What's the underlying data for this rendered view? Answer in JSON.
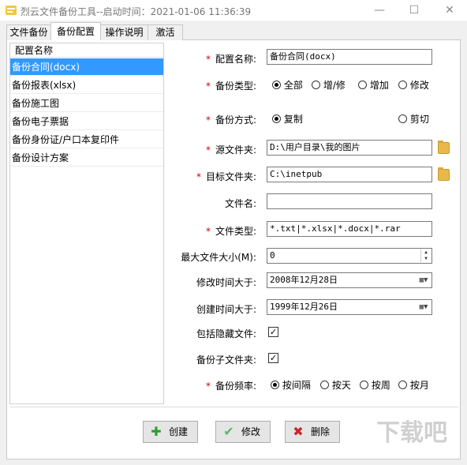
{
  "window": {
    "title": "烈云文件备份工具--启动时间：2021-01-06 11:36:39",
    "minimize_glyph": "—",
    "maximize_glyph": "☐",
    "close_glyph": "✕"
  },
  "tabs": [
    {
      "label": "文件备份"
    },
    {
      "label": "备份配置"
    },
    {
      "label": "操作说明"
    },
    {
      "label": "激活"
    }
  ],
  "config_list": {
    "header": "配置名称",
    "items": [
      {
        "label": "备份合同(docx)",
        "selected": true
      },
      {
        "label": "备份报表(xlsx)"
      },
      {
        "label": "备份施工图"
      },
      {
        "label": "备份电子票据"
      },
      {
        "label": "备份身份证/户口本复印件"
      },
      {
        "label": "备份设计方案"
      }
    ]
  },
  "form": {
    "config_name": {
      "label": "配置名称:",
      "value": "备份合同(docx)"
    },
    "backup_type": {
      "label": "备份类型:",
      "options": [
        "全部",
        "增/修",
        "增加",
        "修改"
      ],
      "selected": "全部"
    },
    "backup_method": {
      "label": "备份方式:",
      "options": [
        "复制",
        "剪切"
      ],
      "selected": "复制"
    },
    "source_folder": {
      "label": "源文件夹:",
      "value": "D:\\用户目录\\我的图片"
    },
    "target_folder": {
      "label": "目标文件夹:",
      "value": "C:\\inetpub"
    },
    "file_name": {
      "label": "文件名:",
      "value": ""
    },
    "file_types": {
      "label": "文件类型:",
      "value": "*.txt|*.xlsx|*.docx|*.rar"
    },
    "max_size": {
      "label": "最大文件大小(M):",
      "value": "0"
    },
    "modified_after": {
      "label": "修改时间大于:",
      "value": "2008年12月28日"
    },
    "created_after": {
      "label": "创建时间大于:",
      "value": "1999年12月26日"
    },
    "include_hidden": {
      "label": "包括隐藏文件:",
      "checked": true
    },
    "include_subfolders": {
      "label": "备份子文件夹:",
      "checked": true
    },
    "frequency": {
      "label": "备份频率:",
      "options": [
        "按间隔",
        "按天",
        "按周",
        "按月"
      ],
      "selected": "按间隔"
    },
    "required_mark": "*"
  },
  "buttons": {
    "create": "创建",
    "modify": "修改",
    "delete": "删除"
  },
  "colors": {
    "selection": "#3399ff",
    "required": "#cc0000",
    "create_icon": "#2a9d2a",
    "modify_icon": "#5cb85c",
    "delete_icon": "#c62828"
  }
}
